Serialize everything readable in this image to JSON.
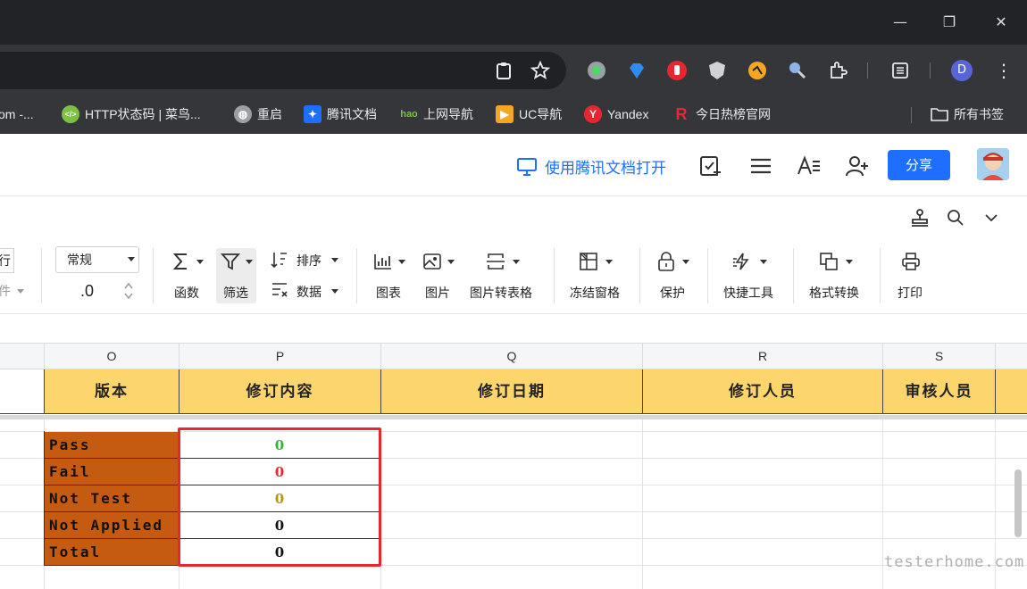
{
  "window": {
    "minimize_glyph": "—",
    "restore_glyph": "❐",
    "close_glyph": "✕"
  },
  "toolbar": {
    "profile_initial": "D"
  },
  "bookmarks": {
    "items": [
      {
        "label": "om -...",
        "icon": "page-icon"
      },
      {
        "label": "HTTP状态码 | 菜鸟...",
        "icon": "runoob-icon"
      },
      {
        "label": "重启",
        "icon": "globe-icon"
      },
      {
        "label": "腾讯文档",
        "icon": "tencent-docs-icon"
      },
      {
        "label": "上网导航",
        "icon": "hao-icon"
      },
      {
        "label": "UC导航",
        "icon": "uc-icon"
      },
      {
        "label": "Yandex",
        "icon": "yandex-icon"
      },
      {
        "label": "今日热榜官网",
        "icon": "rebang-icon"
      }
    ],
    "all_bookmarks": "所有书签"
  },
  "header": {
    "open_in_tencent": "使用腾讯文档打开",
    "share": "分享"
  },
  "ribbon": {
    "wrap_partial": "行",
    "wrap_partial2": "件",
    "number_format": "常规",
    "decimal": ".0",
    "function": "函数",
    "filter": "筛选",
    "sort": "排序",
    "data": "数据",
    "chart": "图表",
    "image": "图片",
    "image_to_table": "图片转表格",
    "freeze": "冻结窗格",
    "protect": "保护",
    "quick_tools": "快捷工具",
    "format_convert": "格式转换",
    "print": "打印"
  },
  "sheet": {
    "columns": [
      "O",
      "P",
      "Q",
      "R",
      "S"
    ],
    "headers": [
      "版本",
      "修订内容",
      "修订日期",
      "修订人员",
      "审核人员"
    ],
    "rows": [
      {
        "label": "Pass",
        "value": "0",
        "color": "#2eb82e"
      },
      {
        "label": "Fail",
        "value": "0",
        "color": "#e8262f"
      },
      {
        "label": "Not Test",
        "value": "0",
        "color": "#b8960c"
      },
      {
        "label": "Not Applied",
        "value": "0",
        "color": "#111111"
      },
      {
        "label": "Total",
        "value": "0",
        "color": "#111111"
      }
    ]
  },
  "watermark": "testerhome.com",
  "colors": {
    "accent": "#1e6fff",
    "header_fill": "#fcd66d",
    "label_fill": "#c55a11",
    "highlight": "#e8262f"
  }
}
